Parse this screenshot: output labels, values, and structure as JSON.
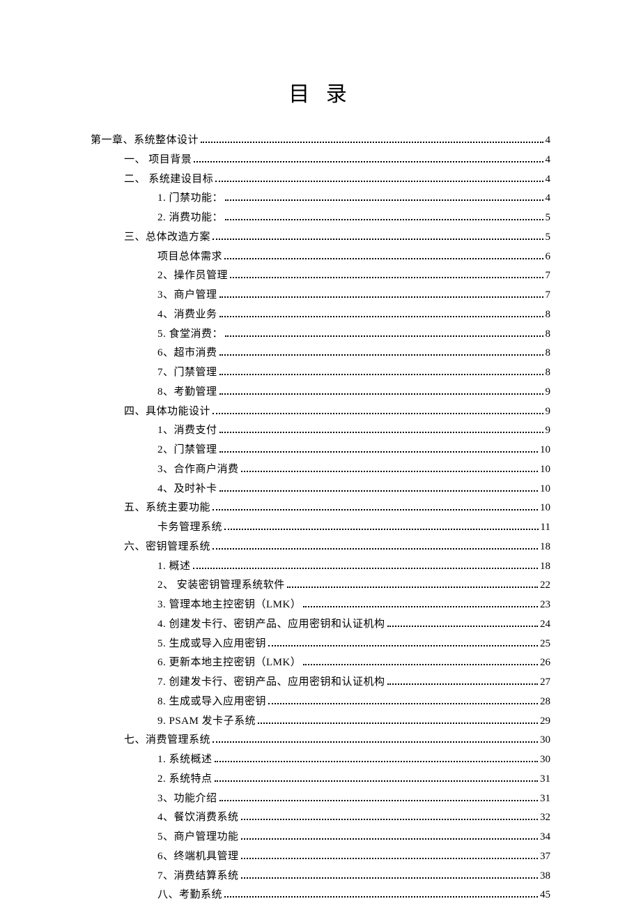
{
  "title": "目 录",
  "toc": [
    {
      "level": 0,
      "label": "第一章、系统整体设计",
      "page": "4"
    },
    {
      "level": 1,
      "label": "一、 项目背景",
      "page": "4"
    },
    {
      "level": 1,
      "label": "二、 系统建设目标",
      "page": "4"
    },
    {
      "level": 2,
      "label": "1. 门禁功能：",
      "page": "4"
    },
    {
      "level": 2,
      "label": "2. 消费功能：",
      "page": "5"
    },
    {
      "level": 1,
      "label": "三、总体改造方案",
      "page": "5"
    },
    {
      "level": 2,
      "label": "项目总体需求",
      "page": "6"
    },
    {
      "level": 2,
      "label": "2、操作员管理",
      "page": "7"
    },
    {
      "level": 2,
      "label": "3、商户管理",
      "page": "7"
    },
    {
      "level": 2,
      "label": "4、消费业务",
      "page": "8"
    },
    {
      "level": 2,
      "label": "5. 食堂消费：",
      "page": "8"
    },
    {
      "level": 2,
      "label": "6、超市消费",
      "page": "8"
    },
    {
      "level": 2,
      "label": "7、门禁管理",
      "page": "8"
    },
    {
      "level": 2,
      "label": "8、考勤管理",
      "page": "9"
    },
    {
      "level": 1,
      "label": "四、具体功能设计",
      "page": "9"
    },
    {
      "level": 2,
      "label": "1、消费支付",
      "page": "9"
    },
    {
      "level": 2,
      "label": "2、门禁管理",
      "page": "10"
    },
    {
      "level": 2,
      "label": "3、合作商户消费",
      "page": "10"
    },
    {
      "level": 2,
      "label": "4、及时补卡",
      "page": "10"
    },
    {
      "level": 1,
      "label": "五、系统主要功能",
      "page": "10"
    },
    {
      "level": 2,
      "label": "卡务管理系统",
      "page": "11"
    },
    {
      "level": 1,
      "label": "六、密钥管理系统",
      "page": "18"
    },
    {
      "level": 2,
      "label": "1. 概述",
      "page": "18"
    },
    {
      "level": 2,
      "label": "2、 安装密钥管理系统软件",
      "page": "22"
    },
    {
      "level": 2,
      "label": "3. 管理本地主控密钥（LMK）",
      "page": "23"
    },
    {
      "level": 2,
      "label": "4. 创建发卡行、密钥产品、应用密钥和认证机构",
      "page": "24"
    },
    {
      "level": 2,
      "label": "5. 生成或导入应用密钥",
      "page": "25"
    },
    {
      "level": 2,
      "label": "6. 更新本地主控密钥（LMK）",
      "page": "26"
    },
    {
      "level": 2,
      "label": "7. 创建发卡行、密钥产品、应用密钥和认证机构",
      "page": "27"
    },
    {
      "level": 2,
      "label": "8. 生成或导入应用密钥",
      "page": "28"
    },
    {
      "level": 2,
      "label": "9. PSAM 发卡子系统",
      "page": "29"
    },
    {
      "level": 1,
      "label": "七、消费管理系统",
      "page": "30"
    },
    {
      "level": 2,
      "label": "1. 系统概述",
      "page": "30"
    },
    {
      "level": 2,
      "label": "2. 系统特点",
      "page": "31"
    },
    {
      "level": 2,
      "label": "3、功能介绍",
      "page": "31"
    },
    {
      "level": 2,
      "label": "4、餐饮消费系统",
      "page": "32"
    },
    {
      "level": 2,
      "label": "5、商户管理功能",
      "page": "34"
    },
    {
      "level": 2,
      "label": "6、终端机具管理",
      "page": "37"
    },
    {
      "level": 2,
      "label": "7、消费结算系统",
      "page": "38"
    },
    {
      "level": 2,
      "label": "八、考勤系统",
      "page": "45"
    }
  ]
}
